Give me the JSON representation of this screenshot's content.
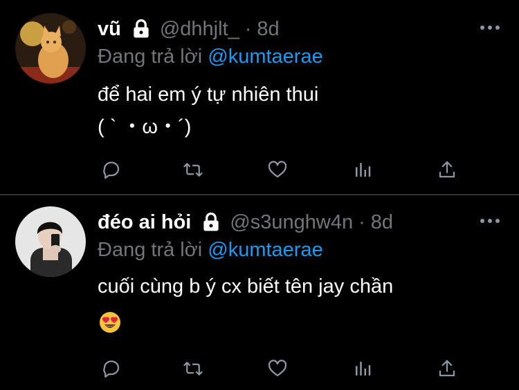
{
  "tweets": [
    {
      "name": "vũ",
      "handle": "@dhhjlt_",
      "separator": "·",
      "time": "8d",
      "replying_prefix": "Đang trả lời",
      "replying_to": "@kumtaerae",
      "text_lines": [
        "để hai em ý tự nhiên thui",
        "( ` ・ω・´)"
      ],
      "avatar": "orange-cat-photo"
    },
    {
      "name": "đéo ai hỏi",
      "handle": "@s3unghw4n",
      "separator": "·",
      "time": "8d",
      "replying_prefix": "Đang trả lời",
      "replying_to": "@kumtaerae",
      "text_lines": [
        "cuối cùng b ý cx biết tên jay chần"
      ],
      "emoji": "heart-eyes-emoji",
      "avatar": "person-mirror-selfie-photo"
    }
  ],
  "icons": [
    "lock-icon",
    "reply-icon",
    "retweet-icon",
    "like-icon",
    "stats-icon",
    "share-icon",
    "more-icon"
  ],
  "colors": {
    "background": "#000000",
    "name": "#ffffff",
    "muted": "#71767b",
    "mention": "#1d9bf0",
    "divider": "#2f3336"
  }
}
